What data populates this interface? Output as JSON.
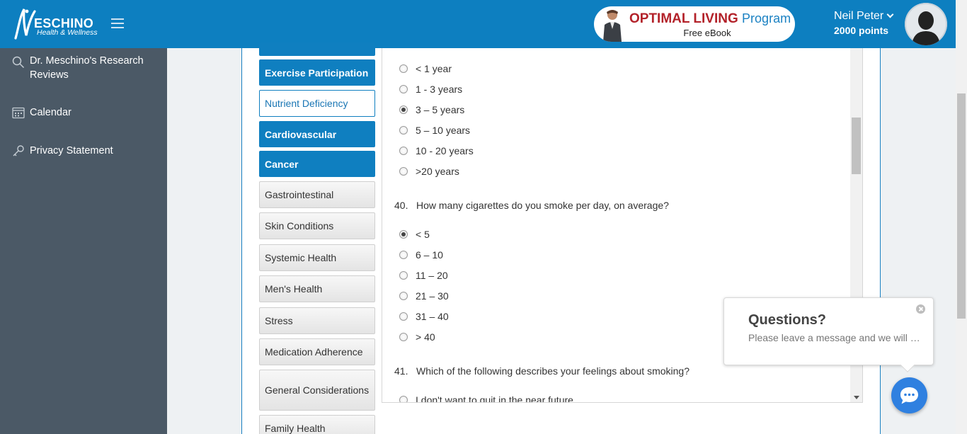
{
  "header": {
    "brand": "ESCHINO",
    "tagline": "Health & Wellness",
    "ebook": {
      "title": "OPTIMAL LIVING",
      "program": "Program",
      "subtitle": "Free eBook"
    },
    "user": {
      "name": "Neil Peter",
      "points": "2000 points"
    }
  },
  "sidebar": {
    "items": [
      {
        "label": "Dr. Meschino's Research Reviews",
        "icon": "search-icon"
      },
      {
        "label": "Calendar",
        "icon": "calendar-icon"
      },
      {
        "label": "Privacy Statement",
        "icon": "key-icon"
      }
    ]
  },
  "categories": [
    {
      "label": "",
      "state": "active"
    },
    {
      "label": "Exercise Participation",
      "state": "active"
    },
    {
      "label": "Nutrient Deficiency",
      "state": "current"
    },
    {
      "label": "Cardiovascular",
      "state": "active"
    },
    {
      "label": "Cancer",
      "state": "active"
    },
    {
      "label": "Gastrointestinal",
      "state": "plain"
    },
    {
      "label": "Skin Conditions",
      "state": "plain"
    },
    {
      "label": "Systemic Health",
      "state": "plain"
    },
    {
      "label": "Men's Health",
      "state": "plain"
    },
    {
      "label": "Stress",
      "state": "plain"
    },
    {
      "label": "Medication Adherence",
      "state": "plain"
    },
    {
      "label": "General Considerations",
      "state": "plain"
    },
    {
      "label": "Family Health",
      "state": "plain"
    }
  ],
  "questions": {
    "q39_options": [
      {
        "label": "< 1 year",
        "selected": false
      },
      {
        "label": "1 - 3 years",
        "selected": false
      },
      {
        "label": "3 – 5 years",
        "selected": true
      },
      {
        "label": "5 – 10 years",
        "selected": false
      },
      {
        "label": "10 - 20 years",
        "selected": false
      },
      {
        "label": ">20 years",
        "selected": false
      }
    ],
    "q40": {
      "number": "40.",
      "text": "How many cigarettes do you smoke per day, on average?",
      "options": [
        {
          "label": "< 5",
          "selected": true
        },
        {
          "label": "6 – 10",
          "selected": false
        },
        {
          "label": "11 – 20",
          "selected": false
        },
        {
          "label": "21 – 30",
          "selected": false
        },
        {
          "label": "31 – 40",
          "selected": false
        },
        {
          "label": "> 40",
          "selected": false
        }
      ]
    },
    "q41": {
      "number": "41.",
      "text": "Which of the following describes your feelings about smoking?",
      "options": [
        {
          "label": "I don't want to quit in the near future",
          "selected": false
        }
      ]
    }
  },
  "chat": {
    "title": "Questions?",
    "message": "Please leave a message and we will help you"
  },
  "colors": {
    "primary": "#0d7fc0",
    "sidebar": "#4b5966",
    "ebook_red": "#b3222a",
    "chat_blue": "#2f80e0"
  }
}
